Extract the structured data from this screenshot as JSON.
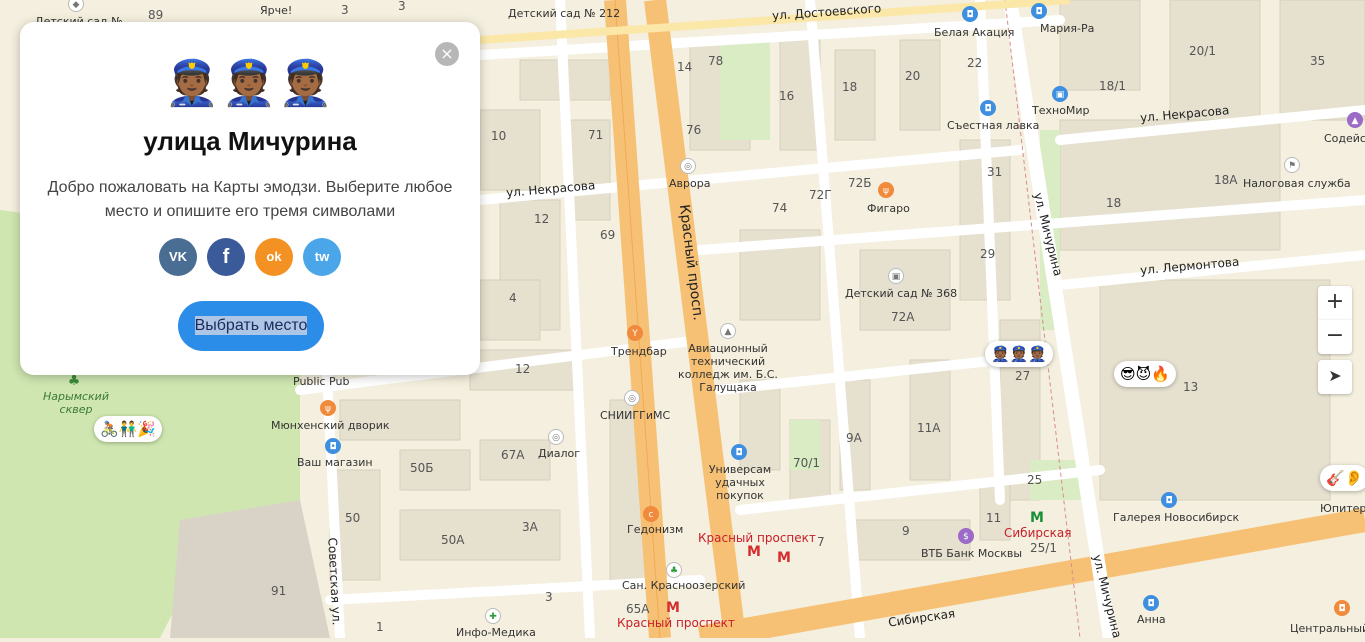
{
  "card": {
    "close_icon": "×",
    "emoji": "👮🏾👮🏾👮🏾",
    "title": "улица Мичурина",
    "description": "Добро пожаловать на Карты эмодзи. Выберите любое место и опишите его тремя символами",
    "social": {
      "vk": "VK",
      "facebook": "f",
      "odnoklassniki": "ok",
      "twitter": "tw"
    },
    "choose_button": "Выбрать место"
  },
  "map_controls": {
    "zoom_in": "+",
    "zoom_out": "−",
    "locate": "➤"
  },
  "emoji_pins": [
    {
      "emoji": "🚴🏽👬🎉"
    },
    {
      "emoji": "👮🏾👮🏾👮🏾"
    },
    {
      "emoji": "😎😈🔥"
    },
    {
      "emoji": "🎸👂"
    }
  ],
  "streets": {
    "dostoevskogo": "ул. Достоевского",
    "nekrasova1": "ул. Некрасова",
    "nekrasova2": "ул. Некрасова",
    "krasny": "Красный просп.",
    "michurina1": "ул. Мичурина",
    "michurina2": "ул. Мичурина",
    "lermontova": "ул. Лермонтова",
    "sovetskaya": "Советская ул.",
    "sibirskaya": "Сибирская"
  },
  "places": {
    "ds212": "Детский сад № 212",
    "ds_top": "Детский сад № ",
    "yarche": "Ярче!",
    "belaya": "Белая Акация",
    "mariya": "Мария-Ра",
    "tehnomir": "ТехноМир",
    "sestnaya": "Съестная лавка",
    "sodeyst": "Содейств",
    "nalog": "Налоговая служба",
    "avrora": "Аврора",
    "figaro": "Фигаро",
    "ds368": "Детский сад № 368",
    "trendbar": "Трендбар",
    "aviation": "Авиационный технический колледж им. Б.С. Галущака",
    "publicpub": "Public Pub",
    "munich": "Мюнхенский дворик",
    "vash": "Ваш магазин",
    "narymsky": "Нарымский сквер",
    "sniiggims": "СНИИГГиМС",
    "dialog": "Диалог",
    "univermag": "Универсам удачных покупок",
    "gedonizm": "Гедонизм",
    "krasny_metro": "Красный проспект",
    "krasny_metro2": "Красный проспект",
    "vtb": "ВТБ Банк Москвы",
    "sibirskaya_metro": "Сибирская",
    "galereya": "Галерея Новосибирск",
    "yupiter": "Юпитер",
    "sanatoriy": "Сан. Красноозерский",
    "infomedika": "Инфо-Медика",
    "anna": "Анна",
    "centralny": "Центральный"
  },
  "house_numbers": {
    "h89": "89",
    "h3a": "3",
    "h3b": "3",
    "h14": "14",
    "h78": "78",
    "h20": "20",
    "h22": "22",
    "h35": "35",
    "h201": "20/1",
    "h181": "18/1",
    "h16": "16",
    "h18a": "18",
    "h76": "76",
    "h71": "71",
    "h10": "10",
    "h72b": "72Б",
    "h72g": "72Г",
    "h74": "74",
    "h31": "31",
    "h18A": "18А",
    "h18b": "18",
    "h12a": "12",
    "h69": "69",
    "h29": "29",
    "h4": "4",
    "h72a": "72А",
    "h12b": "12",
    "h27": "27",
    "h13": "13",
    "h9a": "9А",
    "h11a": "11А",
    "h701": "70/1",
    "h67a": "67А",
    "h50b": "50Б",
    "h50": "50",
    "h3a2": "3А",
    "h50a": "50А",
    "h25": "25",
    "h9": "9",
    "h7": "7",
    "h11": "11",
    "h251": "25/1",
    "h91": "91",
    "h65a": "65А",
    "h1": "1",
    "h3c": "3"
  }
}
